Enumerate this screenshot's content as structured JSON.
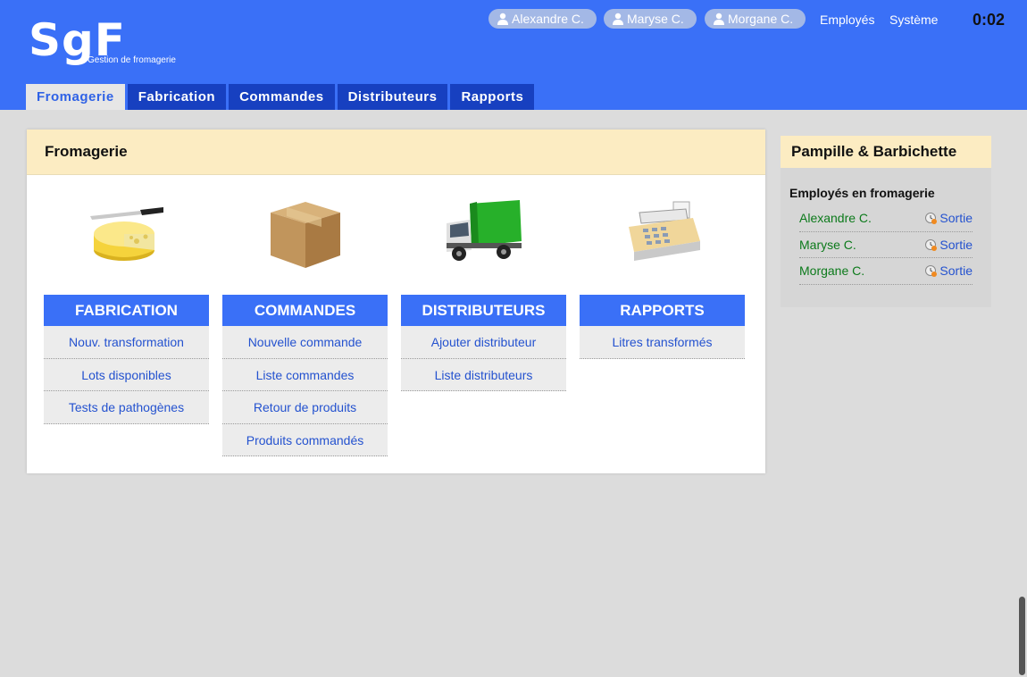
{
  "header": {
    "logo": "SgF",
    "logo_sub": "Gestion de fromagerie",
    "users": [
      "Alexandre C.",
      "Maryse C.",
      "Morgane C."
    ],
    "links": {
      "employes": "Employés",
      "systeme": "Système"
    },
    "clock": "0:02",
    "tabs": [
      "Fromagerie",
      "Fabrication",
      "Commandes",
      "Distributeurs",
      "Rapports"
    ],
    "active_tab": "Fromagerie"
  },
  "main": {
    "title": "Fromagerie",
    "columns": [
      {
        "title": "FABRICATION",
        "icon": "cheese-knife-icon",
        "items": [
          "Nouv. transformation",
          "Lots disponibles",
          "Tests de pathogènes"
        ]
      },
      {
        "title": "COMMANDES",
        "icon": "box-icon",
        "items": [
          "Nouvelle commande",
          "Liste commandes",
          "Retour de produits",
          "Produits commandés"
        ]
      },
      {
        "title": "DISTRIBUTEURS",
        "icon": "truck-icon",
        "items": [
          "Ajouter distributeur",
          "Liste distributeurs"
        ]
      },
      {
        "title": "RAPPORTS",
        "icon": "cash-register-icon",
        "items": [
          "Litres transformés"
        ]
      }
    ]
  },
  "side": {
    "title": "Pampille & Barbichette",
    "subtitle": "Employés en fromagerie",
    "out_label": "Sortie",
    "employees": [
      "Alexandre C.",
      "Maryse C.",
      "Morgane C."
    ]
  },
  "colors": {
    "header_blue": "#3a70f7",
    "tab_dark_blue": "#1740c0",
    "panel_head_cream": "#fcecc2",
    "link_blue": "#2452cf",
    "employee_green": "#0c7a1b"
  }
}
